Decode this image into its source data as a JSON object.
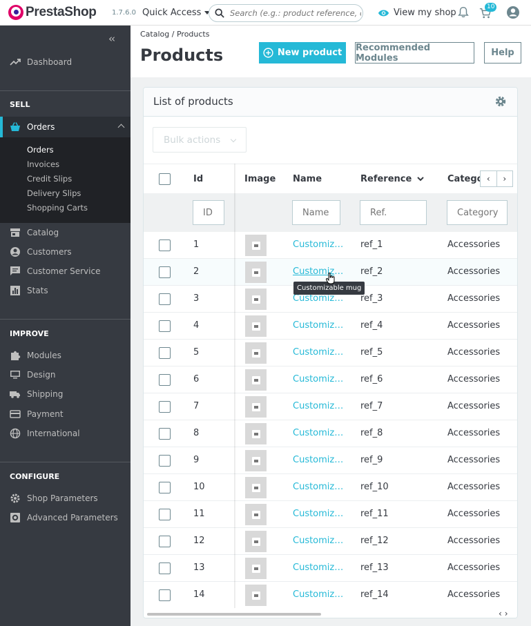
{
  "header": {
    "brand": "PrestaShop",
    "version": "1.7.6.0",
    "quick_access": "Quick Access",
    "search_placeholder": "Search (e.g.: product reference, customer name…)",
    "view_shop": "View my shop",
    "cart_badge": "10",
    "accent_color": "#25b9d7"
  },
  "sidebar": {
    "collapse_glyph": "‹‹",
    "dashboard": "Dashboard",
    "sections": {
      "sell": "SELL",
      "improve": "IMPROVE",
      "configure": "CONFIGURE"
    },
    "orders": "Orders",
    "orders_sub": [
      "Orders",
      "Invoices",
      "Credit Slips",
      "Delivery Slips",
      "Shopping Carts"
    ],
    "sell_items": [
      "Catalog",
      "Customers",
      "Customer Service",
      "Stats"
    ],
    "improve_items": [
      "Modules",
      "Design",
      "Shipping",
      "Payment",
      "International"
    ],
    "configure_items": [
      "Shop Parameters",
      "Advanced Parameters"
    ]
  },
  "page": {
    "breadcrumb_parent": "Catalog",
    "breadcrumb_sep": "/",
    "breadcrumb_current": "Products",
    "title": "Products",
    "new_product": "New product",
    "recommended": "Recommended Modules",
    "help": "Help"
  },
  "card": {
    "title": "List of products",
    "bulk_actions": "Bulk actions",
    "columns": {
      "id": "Id",
      "image": "Image",
      "name": "Name",
      "reference": "Reference",
      "category": "Catego"
    },
    "filters": {
      "id": "ID",
      "name": "Name",
      "reference": "Ref.",
      "category": "Category"
    },
    "tooltip": "Customizable mug",
    "rows": [
      {
        "id": "1",
        "name": "Customizable mug",
        "reference": "ref_1",
        "category": "Accessories"
      },
      {
        "id": "2",
        "name": "Customizable mug",
        "reference": "ref_2",
        "category": "Accessories"
      },
      {
        "id": "3",
        "name": "Customizable mug",
        "reference": "ref_3",
        "category": "Accessories"
      },
      {
        "id": "4",
        "name": "Customizable mug",
        "reference": "ref_4",
        "category": "Accessories"
      },
      {
        "id": "5",
        "name": "Customizable mug",
        "reference": "ref_5",
        "category": "Accessories"
      },
      {
        "id": "6",
        "name": "Customizable mug",
        "reference": "ref_6",
        "category": "Accessories"
      },
      {
        "id": "7",
        "name": "Customizable mug",
        "reference": "ref_7",
        "category": "Accessories"
      },
      {
        "id": "8",
        "name": "Customizable mug",
        "reference": "ref_8",
        "category": "Accessories"
      },
      {
        "id": "9",
        "name": "Customizable mug",
        "reference": "ref_9",
        "category": "Accessories"
      },
      {
        "id": "10",
        "name": "Customizable mug",
        "reference": "ref_10",
        "category": "Accessories"
      },
      {
        "id": "11",
        "name": "Customizable mug",
        "reference": "ref_11",
        "category": "Accessories"
      },
      {
        "id": "12",
        "name": "Customizable mug",
        "reference": "ref_12",
        "category": "Accessories"
      },
      {
        "id": "13",
        "name": "Customizable mug",
        "reference": "ref_13",
        "category": "Accessories"
      },
      {
        "id": "14",
        "name": "Customizable mug",
        "reference": "ref_14",
        "category": "Accessories"
      }
    ]
  }
}
